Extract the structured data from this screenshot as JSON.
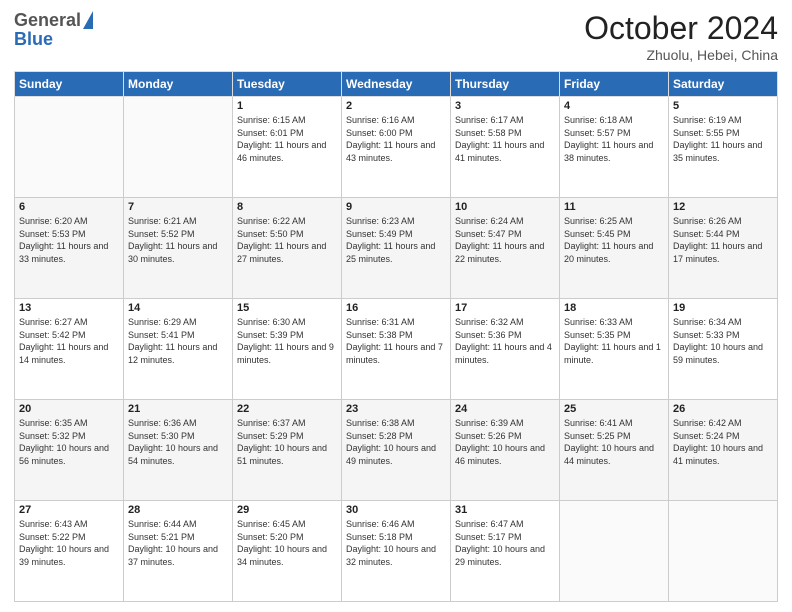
{
  "header": {
    "logo_general": "General",
    "logo_blue": "Blue",
    "title": "October 2024",
    "subtitle": "Zhuolu, Hebei, China"
  },
  "days_of_week": [
    "Sunday",
    "Monday",
    "Tuesday",
    "Wednesday",
    "Thursday",
    "Friday",
    "Saturday"
  ],
  "weeks": [
    [
      null,
      null,
      {
        "day": "1",
        "sunrise": "Sunrise: 6:15 AM",
        "sunset": "Sunset: 6:01 PM",
        "daylight": "Daylight: 11 hours and 46 minutes."
      },
      {
        "day": "2",
        "sunrise": "Sunrise: 6:16 AM",
        "sunset": "Sunset: 6:00 PM",
        "daylight": "Daylight: 11 hours and 43 minutes."
      },
      {
        "day": "3",
        "sunrise": "Sunrise: 6:17 AM",
        "sunset": "Sunset: 5:58 PM",
        "daylight": "Daylight: 11 hours and 41 minutes."
      },
      {
        "day": "4",
        "sunrise": "Sunrise: 6:18 AM",
        "sunset": "Sunset: 5:57 PM",
        "daylight": "Daylight: 11 hours and 38 minutes."
      },
      {
        "day": "5",
        "sunrise": "Sunrise: 6:19 AM",
        "sunset": "Sunset: 5:55 PM",
        "daylight": "Daylight: 11 hours and 35 minutes."
      }
    ],
    [
      {
        "day": "6",
        "sunrise": "Sunrise: 6:20 AM",
        "sunset": "Sunset: 5:53 PM",
        "daylight": "Daylight: 11 hours and 33 minutes."
      },
      {
        "day": "7",
        "sunrise": "Sunrise: 6:21 AM",
        "sunset": "Sunset: 5:52 PM",
        "daylight": "Daylight: 11 hours and 30 minutes."
      },
      {
        "day": "8",
        "sunrise": "Sunrise: 6:22 AM",
        "sunset": "Sunset: 5:50 PM",
        "daylight": "Daylight: 11 hours and 27 minutes."
      },
      {
        "day": "9",
        "sunrise": "Sunrise: 6:23 AM",
        "sunset": "Sunset: 5:49 PM",
        "daylight": "Daylight: 11 hours and 25 minutes."
      },
      {
        "day": "10",
        "sunrise": "Sunrise: 6:24 AM",
        "sunset": "Sunset: 5:47 PM",
        "daylight": "Daylight: 11 hours and 22 minutes."
      },
      {
        "day": "11",
        "sunrise": "Sunrise: 6:25 AM",
        "sunset": "Sunset: 5:45 PM",
        "daylight": "Daylight: 11 hours and 20 minutes."
      },
      {
        "day": "12",
        "sunrise": "Sunrise: 6:26 AM",
        "sunset": "Sunset: 5:44 PM",
        "daylight": "Daylight: 11 hours and 17 minutes."
      }
    ],
    [
      {
        "day": "13",
        "sunrise": "Sunrise: 6:27 AM",
        "sunset": "Sunset: 5:42 PM",
        "daylight": "Daylight: 11 hours and 14 minutes."
      },
      {
        "day": "14",
        "sunrise": "Sunrise: 6:29 AM",
        "sunset": "Sunset: 5:41 PM",
        "daylight": "Daylight: 11 hours and 12 minutes."
      },
      {
        "day": "15",
        "sunrise": "Sunrise: 6:30 AM",
        "sunset": "Sunset: 5:39 PM",
        "daylight": "Daylight: 11 hours and 9 minutes."
      },
      {
        "day": "16",
        "sunrise": "Sunrise: 6:31 AM",
        "sunset": "Sunset: 5:38 PM",
        "daylight": "Daylight: 11 hours and 7 minutes."
      },
      {
        "day": "17",
        "sunrise": "Sunrise: 6:32 AM",
        "sunset": "Sunset: 5:36 PM",
        "daylight": "Daylight: 11 hours and 4 minutes."
      },
      {
        "day": "18",
        "sunrise": "Sunrise: 6:33 AM",
        "sunset": "Sunset: 5:35 PM",
        "daylight": "Daylight: 11 hours and 1 minute."
      },
      {
        "day": "19",
        "sunrise": "Sunrise: 6:34 AM",
        "sunset": "Sunset: 5:33 PM",
        "daylight": "Daylight: 10 hours and 59 minutes."
      }
    ],
    [
      {
        "day": "20",
        "sunrise": "Sunrise: 6:35 AM",
        "sunset": "Sunset: 5:32 PM",
        "daylight": "Daylight: 10 hours and 56 minutes."
      },
      {
        "day": "21",
        "sunrise": "Sunrise: 6:36 AM",
        "sunset": "Sunset: 5:30 PM",
        "daylight": "Daylight: 10 hours and 54 minutes."
      },
      {
        "day": "22",
        "sunrise": "Sunrise: 6:37 AM",
        "sunset": "Sunset: 5:29 PM",
        "daylight": "Daylight: 10 hours and 51 minutes."
      },
      {
        "day": "23",
        "sunrise": "Sunrise: 6:38 AM",
        "sunset": "Sunset: 5:28 PM",
        "daylight": "Daylight: 10 hours and 49 minutes."
      },
      {
        "day": "24",
        "sunrise": "Sunrise: 6:39 AM",
        "sunset": "Sunset: 5:26 PM",
        "daylight": "Daylight: 10 hours and 46 minutes."
      },
      {
        "day": "25",
        "sunrise": "Sunrise: 6:41 AM",
        "sunset": "Sunset: 5:25 PM",
        "daylight": "Daylight: 10 hours and 44 minutes."
      },
      {
        "day": "26",
        "sunrise": "Sunrise: 6:42 AM",
        "sunset": "Sunset: 5:24 PM",
        "daylight": "Daylight: 10 hours and 41 minutes."
      }
    ],
    [
      {
        "day": "27",
        "sunrise": "Sunrise: 6:43 AM",
        "sunset": "Sunset: 5:22 PM",
        "daylight": "Daylight: 10 hours and 39 minutes."
      },
      {
        "day": "28",
        "sunrise": "Sunrise: 6:44 AM",
        "sunset": "Sunset: 5:21 PM",
        "daylight": "Daylight: 10 hours and 37 minutes."
      },
      {
        "day": "29",
        "sunrise": "Sunrise: 6:45 AM",
        "sunset": "Sunset: 5:20 PM",
        "daylight": "Daylight: 10 hours and 34 minutes."
      },
      {
        "day": "30",
        "sunrise": "Sunrise: 6:46 AM",
        "sunset": "Sunset: 5:18 PM",
        "daylight": "Daylight: 10 hours and 32 minutes."
      },
      {
        "day": "31",
        "sunrise": "Sunrise: 6:47 AM",
        "sunset": "Sunset: 5:17 PM",
        "daylight": "Daylight: 10 hours and 29 minutes."
      },
      null,
      null
    ]
  ]
}
